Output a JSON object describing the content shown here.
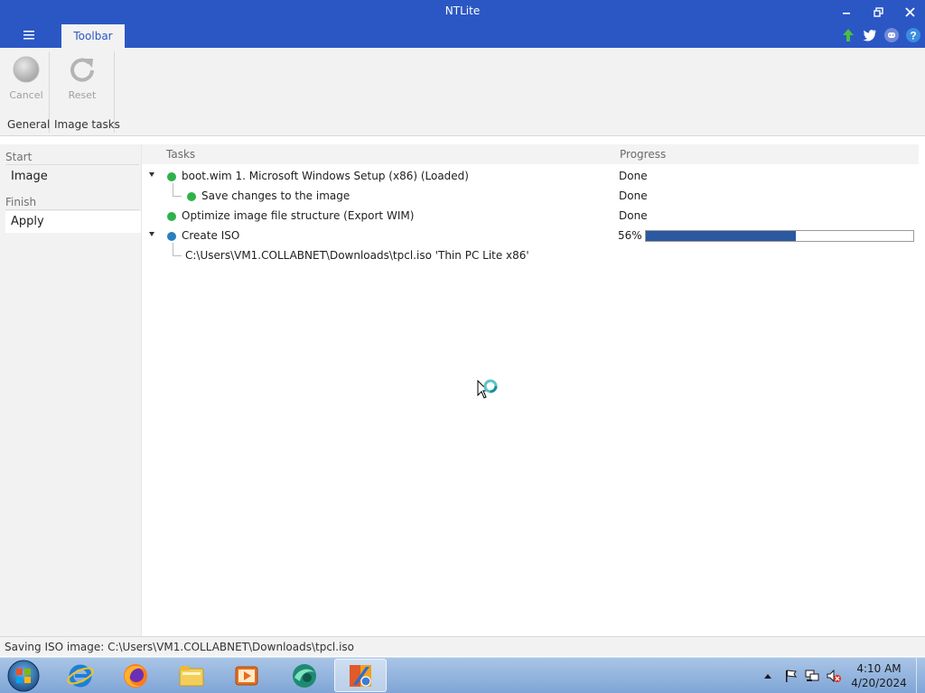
{
  "window": {
    "title": "NTLite"
  },
  "tabs": {
    "toolbar": "Toolbar"
  },
  "ribbon": {
    "cancel_label": "Cancel",
    "reset_label": "Reset",
    "group_general": "General",
    "group_image_tasks": "Image tasks"
  },
  "sidebar": {
    "start_header": "Start",
    "image_item": "Image",
    "finish_header": "Finish",
    "apply_item": "Apply"
  },
  "tasks": {
    "col_tasks": "Tasks",
    "col_progress": "Progress",
    "rows": [
      {
        "label": "boot.wim 1. Microsoft Windows Setup (x86)  (Loaded)",
        "status": "Done",
        "dot": "green"
      },
      {
        "label": "Save changes to the image",
        "status": "Done",
        "dot": "green"
      },
      {
        "label": "Optimize image file structure (Export WIM)",
        "status": "Done",
        "dot": "green"
      },
      {
        "label": "Create ISO",
        "progress_text": "56%",
        "progress": 0.56,
        "dot": "blue"
      },
      {
        "label": "C:\\Users\\VM1.COLLABNET\\Downloads\\tpcl.iso 'Thin PC Lite x86'"
      }
    ]
  },
  "statusbar": {
    "text": "Saving ISO image: C:\\Users\\VM1.COLLABNET\\Downloads\\tpcl.iso"
  },
  "taskbar": {
    "items": [
      "start-orb",
      "internet-explorer-icon",
      "firefox-icon",
      "file-explorer-icon",
      "media-player-icon",
      "ntlite-alt-icon",
      "ntlite-icon"
    ],
    "clock_time": "4:10 AM",
    "clock_date": "4/20/2024"
  },
  "colors": {
    "accent": "#2b57c4",
    "done_dot": "#2fb24a",
    "running_dot": "#2a7fc0",
    "progress_fill": "#2b58a0"
  }
}
